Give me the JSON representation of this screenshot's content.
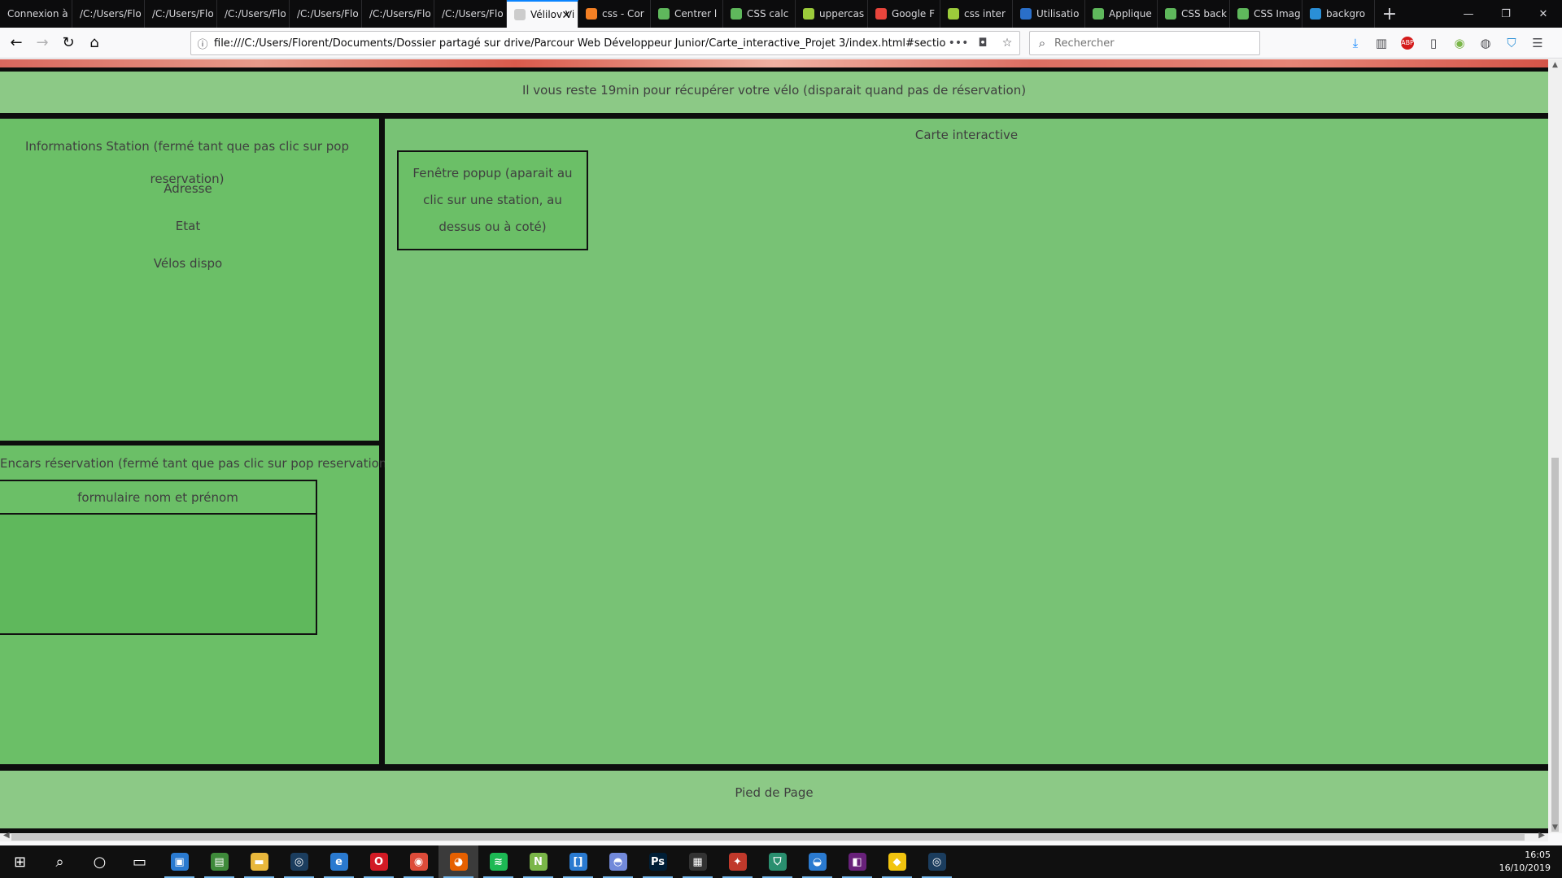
{
  "browser": {
    "tabs": [
      {
        "label": "Connexion à",
        "color": "#5a5a5a"
      },
      {
        "label": "/C:/Users/Flo",
        "color": "#5a5a5a"
      },
      {
        "label": "/C:/Users/Flo",
        "color": "#5a5a5a"
      },
      {
        "label": "/C:/Users/Flo",
        "color": "#5a5a5a"
      },
      {
        "label": "/C:/Users/Flo",
        "color": "#5a5a5a"
      },
      {
        "label": "/C:/Users/Flo",
        "color": "#5a5a5a"
      },
      {
        "label": "/C:/Users/Flo",
        "color": "#5a5a5a"
      },
      {
        "label": "Vélilov Vi",
        "color": "#cccccc",
        "active": true
      },
      {
        "label": "css - Cor",
        "color": "#f48024"
      },
      {
        "label": "Centrer l",
        "color": "#5fb85c"
      },
      {
        "label": "CSS calc",
        "color": "#5fb85c"
      },
      {
        "label": "uppercas",
        "color": "#9ccc3b"
      },
      {
        "label": "Google F",
        "color": "#e8453c"
      },
      {
        "label": "css inter",
        "color": "#9ccc3b"
      },
      {
        "label": "Utilisatio",
        "color": "#2a6fc9"
      },
      {
        "label": "Applique",
        "color": "#5fb85c"
      },
      {
        "label": "CSS back",
        "color": "#5fb85c"
      },
      {
        "label": "CSS Imag",
        "color": "#5fb85c"
      },
      {
        "label": "backgro",
        "color": "#2a8fd6"
      }
    ],
    "new_tab": "+",
    "url": "file:///C:/Users/Florent/Documents/Dossier partagé sur drive/Parcour Web Développeur Junior/Carte_interactive_Projet 3/index.html#sectionCa",
    "search_placeholder": "Rechercher",
    "page_actions": "•••",
    "icons": [
      "back-icon",
      "forward-icon",
      "reload-icon",
      "home-icon",
      "info-icon",
      "pocket-icon",
      "bookmark-star-icon",
      "search-icon",
      "download-icon",
      "library-icon",
      "adblock-icon",
      "sidebar-icon",
      "extension-icon",
      "account-icon",
      "shield-icon",
      "menu-icon"
    ]
  },
  "page": {
    "timer_text": "Il vous reste 19min pour récupérer votre vélo (disparait quand pas de réservation)",
    "station": {
      "title": "Informations Station (fermé tant que pas clic sur pop reservation)",
      "address_label": "Adresse",
      "status_label": "Etat",
      "bikes_label": "Vélos dispo"
    },
    "reservation": {
      "title": "Encars réservation (fermé tant que pas clic sur pop reservation)",
      "form_label": "formulaire nom et prénom"
    },
    "map": {
      "title": "Carte interactive",
      "popup_text": "Fenêtre popup (aparait au clic sur une station, au dessus ou à coté)"
    },
    "footer_text": "Pied de Page",
    "colors": {
      "light_green": "#8cc986",
      "mid_green": "#78c275",
      "panel_green": "#6bbf67",
      "border": "#0d0d0d"
    }
  },
  "taskbar": {
    "apps": [
      {
        "name": "start-icon",
        "color": "#101010",
        "glyph": "⊞"
      },
      {
        "name": "search-icon",
        "color": "#101010",
        "glyph": "⌕"
      },
      {
        "name": "cortana-icon",
        "color": "#101010",
        "glyph": "○"
      },
      {
        "name": "task-view-icon",
        "color": "#101010",
        "glyph": "▭"
      },
      {
        "name": "control-panel-icon",
        "color": "#2a7ad0",
        "glyph": "▣"
      },
      {
        "name": "photos-icon",
        "color": "#3e8a3a",
        "glyph": "▤"
      },
      {
        "name": "file-explorer-icon",
        "color": "#e8b73c",
        "glyph": "▬"
      },
      {
        "name": "steam-icon",
        "color": "#1b3d5e",
        "glyph": "◎"
      },
      {
        "name": "edge-icon",
        "color": "#2a7ad0",
        "glyph": "e"
      },
      {
        "name": "opera-icon",
        "color": "#d21a24",
        "glyph": "O"
      },
      {
        "name": "chrome-icon",
        "color": "#dd4b39",
        "glyph": "◉"
      },
      {
        "name": "firefox-icon",
        "color": "#e66000",
        "glyph": "◕",
        "active": true
      },
      {
        "name": "spotify-icon",
        "color": "#1db954",
        "glyph": "≋"
      },
      {
        "name": "notepad-plus-icon",
        "color": "#7ab648",
        "glyph": "N"
      },
      {
        "name": "brackets-icon",
        "color": "#2a7ad0",
        "glyph": "[]"
      },
      {
        "name": "discord-icon",
        "color": "#7289da",
        "glyph": "◓"
      },
      {
        "name": "photoshop-icon",
        "color": "#001e36",
        "glyph": "Ps"
      },
      {
        "name": "terminal-icon",
        "color": "#333333",
        "glyph": "▦"
      },
      {
        "name": "puzzle-icon",
        "color": "#c0392b",
        "glyph": "✦"
      },
      {
        "name": "security-icon",
        "color": "#2a8f6f",
        "glyph": "⛉"
      },
      {
        "name": "vpn-icon",
        "color": "#2a7ad0",
        "glyph": "◒"
      },
      {
        "name": "visual-studio-icon",
        "color": "#68217a",
        "glyph": "◧"
      },
      {
        "name": "git-icon",
        "color": "#f1c40f",
        "glyph": "◆"
      },
      {
        "name": "steam-icon-2",
        "color": "#1b3d5e",
        "glyph": "◎"
      }
    ],
    "time": "16:05",
    "date": "16/10/2019"
  }
}
